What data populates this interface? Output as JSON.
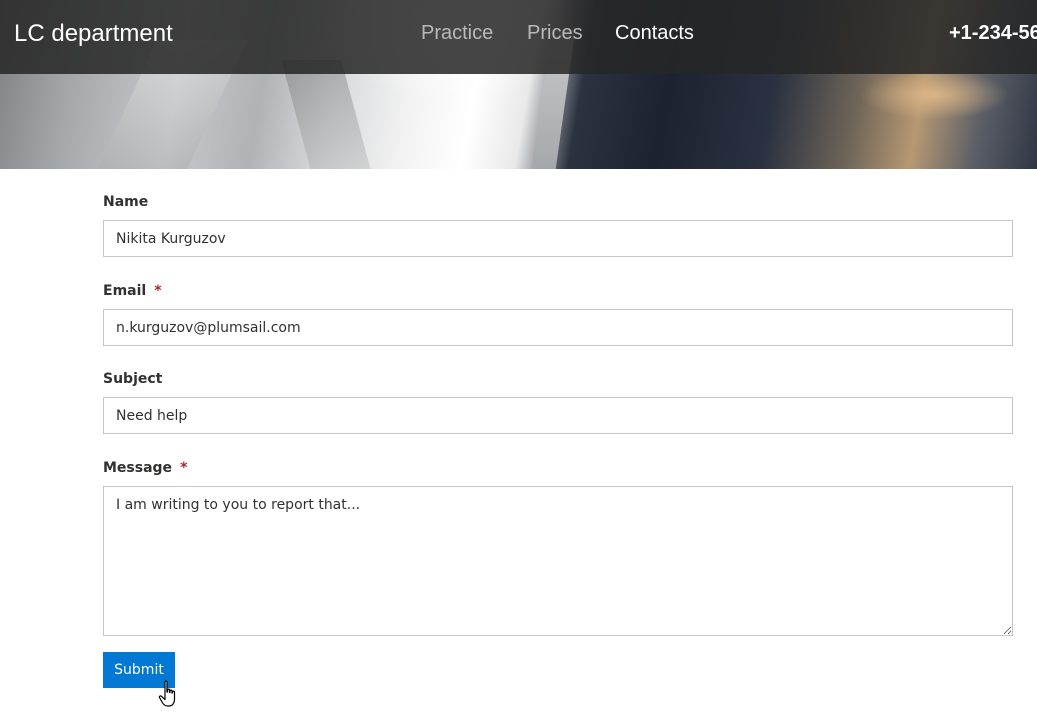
{
  "header": {
    "brand": "LC department",
    "nav": [
      {
        "label": "Practice",
        "active": false
      },
      {
        "label": "Prices",
        "active": false
      },
      {
        "label": "Contacts",
        "active": true
      }
    ],
    "phone": "+1-234-56"
  },
  "form": {
    "name": {
      "label": "Name",
      "value": "Nikita Kurguzov"
    },
    "email": {
      "label": "Email",
      "required_mark": "*",
      "value": "n.kurguzov@plumsail.com"
    },
    "subject": {
      "label": "Subject",
      "value": "Need help"
    },
    "message": {
      "label": "Message",
      "required_mark": "*",
      "value": "I am writing to you to report that..."
    },
    "submit_label": "Submit"
  },
  "colors": {
    "accent": "#0078d4",
    "required": "#a4262c",
    "navbar": "#262626"
  },
  "icons": {
    "cursor": "hand-pointer-icon"
  }
}
